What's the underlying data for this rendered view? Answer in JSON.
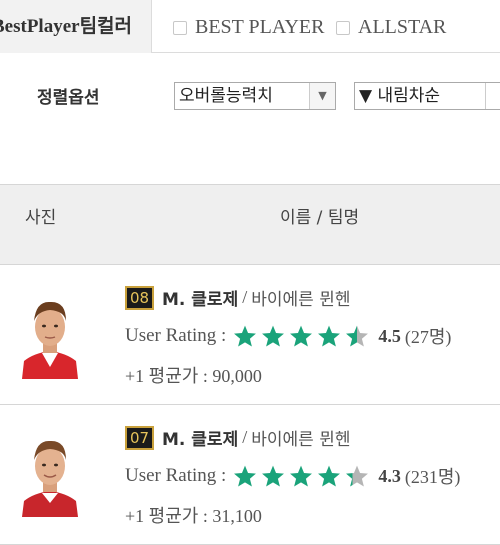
{
  "filters": {
    "team_color_label": "BestPlayer팀컬러",
    "options": [
      {
        "label": "BEST PLAYER",
        "checked": false
      },
      {
        "label": "ALLSTAR",
        "checked": false
      }
    ]
  },
  "sort": {
    "label": "정렬옵션",
    "field_value": "오버롤능력치",
    "order_value": "▼ 내림차순"
  },
  "table_header": {
    "photo": "사진",
    "name_team": "이름 / 팀명"
  },
  "players": [
    {
      "season": "08",
      "name": "M. 클로제",
      "team": "바이에른 뮌헨",
      "rating_label": "User Rating :",
      "rating": 4.5,
      "rating_text": "4.5",
      "votes": "(27명)",
      "price_label": "+1 평균가 :",
      "price": "90,000"
    },
    {
      "season": "07",
      "name": "M. 클로제",
      "team": "바이에른 뮌헨",
      "rating_label": "User Rating :",
      "rating": 4.3,
      "rating_text": "4.3",
      "votes": "(231명)",
      "price_label": "+1 평균가 :",
      "price": "31,100"
    }
  ],
  "colors": {
    "star_filled": "#1aa37a",
    "star_empty": "#b5b5b5",
    "badge_border": "#c9a13c",
    "header_bg": "#efefef"
  }
}
